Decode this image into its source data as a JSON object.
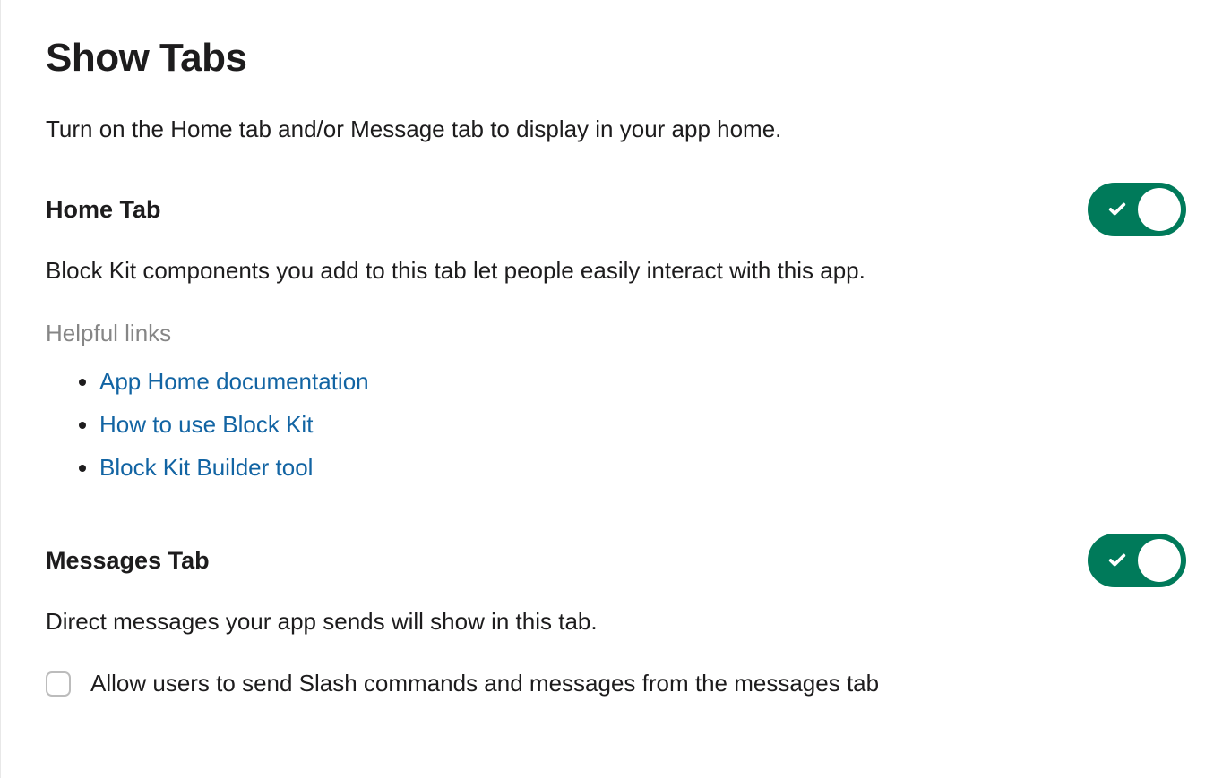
{
  "page": {
    "title": "Show Tabs",
    "description": "Turn on the Home tab and/or Message tab to display in your app home."
  },
  "homeTab": {
    "title": "Home Tab",
    "description": "Block Kit components you add to this tab let people easily interact with this app.",
    "toggleOn": true,
    "helpfulLinksHeading": "Helpful links",
    "links": [
      {
        "label": "App Home documentation"
      },
      {
        "label": "How to use Block Kit"
      },
      {
        "label": "Block Kit Builder tool"
      }
    ]
  },
  "messagesTab": {
    "title": "Messages Tab",
    "description": "Direct messages your app sends will show in this tab.",
    "toggleOn": true,
    "checkbox": {
      "checked": false,
      "label": "Allow users to send Slash commands and messages from the messages tab"
    }
  }
}
